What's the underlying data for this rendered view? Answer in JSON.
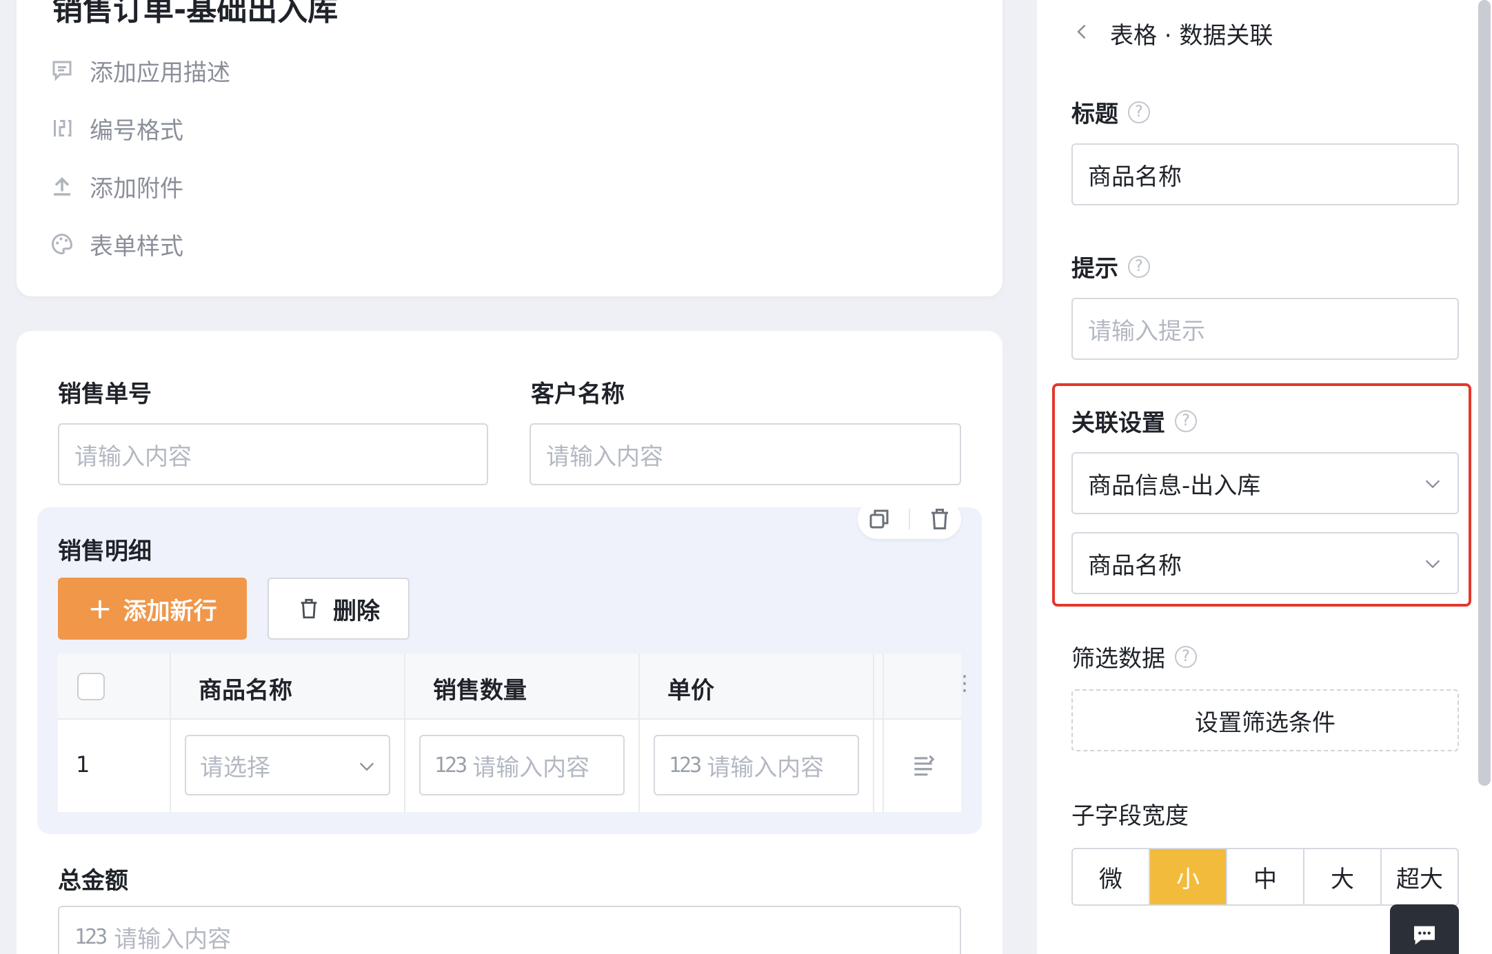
{
  "form": {
    "title": "销售订单-基础出入库",
    "menu": {
      "add_description": "添加应用描述",
      "number_format": "编号格式",
      "add_attachment": "添加附件",
      "form_style": "表单样式"
    }
  },
  "fields": {
    "order_no": {
      "label": "销售单号",
      "placeholder": "请输入内容"
    },
    "customer": {
      "label": "客户名称",
      "placeholder": "请输入内容"
    },
    "total": {
      "label": "总金额",
      "placeholder": "请输入内容"
    }
  },
  "subtable": {
    "title": "销售明细",
    "add_button": "添加新行",
    "delete_button": "删除",
    "columns": [
      "商品名称",
      "销售数量",
      "单价"
    ],
    "row": {
      "index": "1",
      "select_placeholder": "请选择",
      "qty_placeholder": "请输入内容",
      "price_placeholder": "请输入内容"
    },
    "num_icon": "123"
  },
  "panel": {
    "breadcrumb": "表格 · 数据关联",
    "title_label": "标题",
    "title_value": "商品名称",
    "hint_label": "提示",
    "hint_placeholder": "请输入提示",
    "link_label": "关联设置",
    "link_form": "商品信息-出入库",
    "link_field": "商品名称",
    "filter_label": "筛选数据",
    "filter_button": "设置筛选条件",
    "width_label": "子字段宽度",
    "width_options": [
      "微",
      "小",
      "中",
      "大",
      "超大"
    ],
    "width_selected": "小"
  },
  "help_glyph": "?",
  "colors": {
    "accent_orange": "#f0974a",
    "active_yellow": "#f2bb3c",
    "highlight_red": "#e3382e"
  }
}
